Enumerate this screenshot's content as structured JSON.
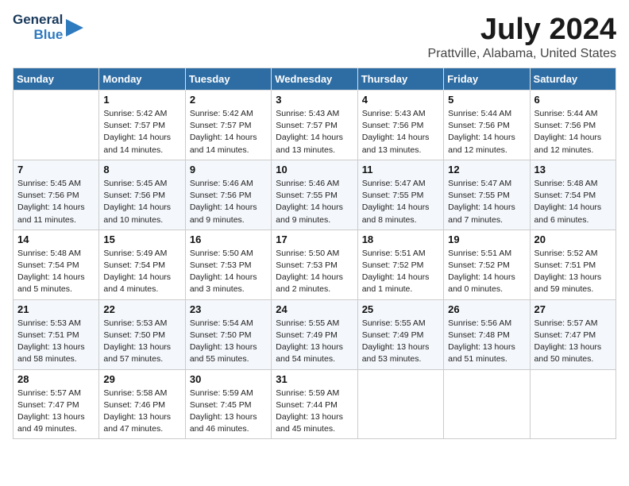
{
  "logo": {
    "general": "General",
    "blue": "Blue"
  },
  "title": "July 2024",
  "location": "Prattville, Alabama, United States",
  "days_of_week": [
    "Sunday",
    "Monday",
    "Tuesday",
    "Wednesday",
    "Thursday",
    "Friday",
    "Saturday"
  ],
  "weeks": [
    [
      {
        "day": "",
        "info": ""
      },
      {
        "day": "1",
        "info": "Sunrise: 5:42 AM\nSunset: 7:57 PM\nDaylight: 14 hours\nand 14 minutes."
      },
      {
        "day": "2",
        "info": "Sunrise: 5:42 AM\nSunset: 7:57 PM\nDaylight: 14 hours\nand 14 minutes."
      },
      {
        "day": "3",
        "info": "Sunrise: 5:43 AM\nSunset: 7:57 PM\nDaylight: 14 hours\nand 13 minutes."
      },
      {
        "day": "4",
        "info": "Sunrise: 5:43 AM\nSunset: 7:56 PM\nDaylight: 14 hours\nand 13 minutes."
      },
      {
        "day": "5",
        "info": "Sunrise: 5:44 AM\nSunset: 7:56 PM\nDaylight: 14 hours\nand 12 minutes."
      },
      {
        "day": "6",
        "info": "Sunrise: 5:44 AM\nSunset: 7:56 PM\nDaylight: 14 hours\nand 12 minutes."
      }
    ],
    [
      {
        "day": "7",
        "info": "Sunrise: 5:45 AM\nSunset: 7:56 PM\nDaylight: 14 hours\nand 11 minutes."
      },
      {
        "day": "8",
        "info": "Sunrise: 5:45 AM\nSunset: 7:56 PM\nDaylight: 14 hours\nand 10 minutes."
      },
      {
        "day": "9",
        "info": "Sunrise: 5:46 AM\nSunset: 7:56 PM\nDaylight: 14 hours\nand 9 minutes."
      },
      {
        "day": "10",
        "info": "Sunrise: 5:46 AM\nSunset: 7:55 PM\nDaylight: 14 hours\nand 9 minutes."
      },
      {
        "day": "11",
        "info": "Sunrise: 5:47 AM\nSunset: 7:55 PM\nDaylight: 14 hours\nand 8 minutes."
      },
      {
        "day": "12",
        "info": "Sunrise: 5:47 AM\nSunset: 7:55 PM\nDaylight: 14 hours\nand 7 minutes."
      },
      {
        "day": "13",
        "info": "Sunrise: 5:48 AM\nSunset: 7:54 PM\nDaylight: 14 hours\nand 6 minutes."
      }
    ],
    [
      {
        "day": "14",
        "info": "Sunrise: 5:48 AM\nSunset: 7:54 PM\nDaylight: 14 hours\nand 5 minutes."
      },
      {
        "day": "15",
        "info": "Sunrise: 5:49 AM\nSunset: 7:54 PM\nDaylight: 14 hours\nand 4 minutes."
      },
      {
        "day": "16",
        "info": "Sunrise: 5:50 AM\nSunset: 7:53 PM\nDaylight: 14 hours\nand 3 minutes."
      },
      {
        "day": "17",
        "info": "Sunrise: 5:50 AM\nSunset: 7:53 PM\nDaylight: 14 hours\nand 2 minutes."
      },
      {
        "day": "18",
        "info": "Sunrise: 5:51 AM\nSunset: 7:52 PM\nDaylight: 14 hours\nand 1 minute."
      },
      {
        "day": "19",
        "info": "Sunrise: 5:51 AM\nSunset: 7:52 PM\nDaylight: 14 hours\nand 0 minutes."
      },
      {
        "day": "20",
        "info": "Sunrise: 5:52 AM\nSunset: 7:51 PM\nDaylight: 13 hours\nand 59 minutes."
      }
    ],
    [
      {
        "day": "21",
        "info": "Sunrise: 5:53 AM\nSunset: 7:51 PM\nDaylight: 13 hours\nand 58 minutes."
      },
      {
        "day": "22",
        "info": "Sunrise: 5:53 AM\nSunset: 7:50 PM\nDaylight: 13 hours\nand 57 minutes."
      },
      {
        "day": "23",
        "info": "Sunrise: 5:54 AM\nSunset: 7:50 PM\nDaylight: 13 hours\nand 55 minutes."
      },
      {
        "day": "24",
        "info": "Sunrise: 5:55 AM\nSunset: 7:49 PM\nDaylight: 13 hours\nand 54 minutes."
      },
      {
        "day": "25",
        "info": "Sunrise: 5:55 AM\nSunset: 7:49 PM\nDaylight: 13 hours\nand 53 minutes."
      },
      {
        "day": "26",
        "info": "Sunrise: 5:56 AM\nSunset: 7:48 PM\nDaylight: 13 hours\nand 51 minutes."
      },
      {
        "day": "27",
        "info": "Sunrise: 5:57 AM\nSunset: 7:47 PM\nDaylight: 13 hours\nand 50 minutes."
      }
    ],
    [
      {
        "day": "28",
        "info": "Sunrise: 5:57 AM\nSunset: 7:47 PM\nDaylight: 13 hours\nand 49 minutes."
      },
      {
        "day": "29",
        "info": "Sunrise: 5:58 AM\nSunset: 7:46 PM\nDaylight: 13 hours\nand 47 minutes."
      },
      {
        "day": "30",
        "info": "Sunrise: 5:59 AM\nSunset: 7:45 PM\nDaylight: 13 hours\nand 46 minutes."
      },
      {
        "day": "31",
        "info": "Sunrise: 5:59 AM\nSunset: 7:44 PM\nDaylight: 13 hours\nand 45 minutes."
      },
      {
        "day": "",
        "info": ""
      },
      {
        "day": "",
        "info": ""
      },
      {
        "day": "",
        "info": ""
      }
    ]
  ]
}
